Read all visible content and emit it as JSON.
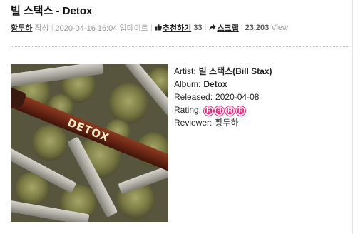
{
  "post": {
    "title": "빌 스택스 - Detox",
    "author": "황두하",
    "author_suffix": "작성",
    "updated": "2020-04-16 16:04 업데이트",
    "recommend_label": "추천하기",
    "recommend_count": "33",
    "scrap_label": "스크랩",
    "views_count": "23,203",
    "views_label": "View"
  },
  "cover": {
    "alt": "Detox album cover",
    "overlay_text": "DETOX"
  },
  "review_info": {
    "artist_label": "Artist:",
    "artist_value": "빌 스택스(Bill Stax)",
    "album_label": "Album:",
    "album_value": "Detox",
    "released_label": "Released:",
    "released_value": "2020-04-08",
    "rating_label": "Rating:",
    "rating_value": 4,
    "rating_badge_letter": "R",
    "reviewer_label": "Reviewer:",
    "reviewer_value": "황두하"
  },
  "colors": {
    "rating_badge": "#e8257c"
  },
  "icons": {
    "recommend": "thumbs-up-icon",
    "scrap": "scrap-icon"
  }
}
